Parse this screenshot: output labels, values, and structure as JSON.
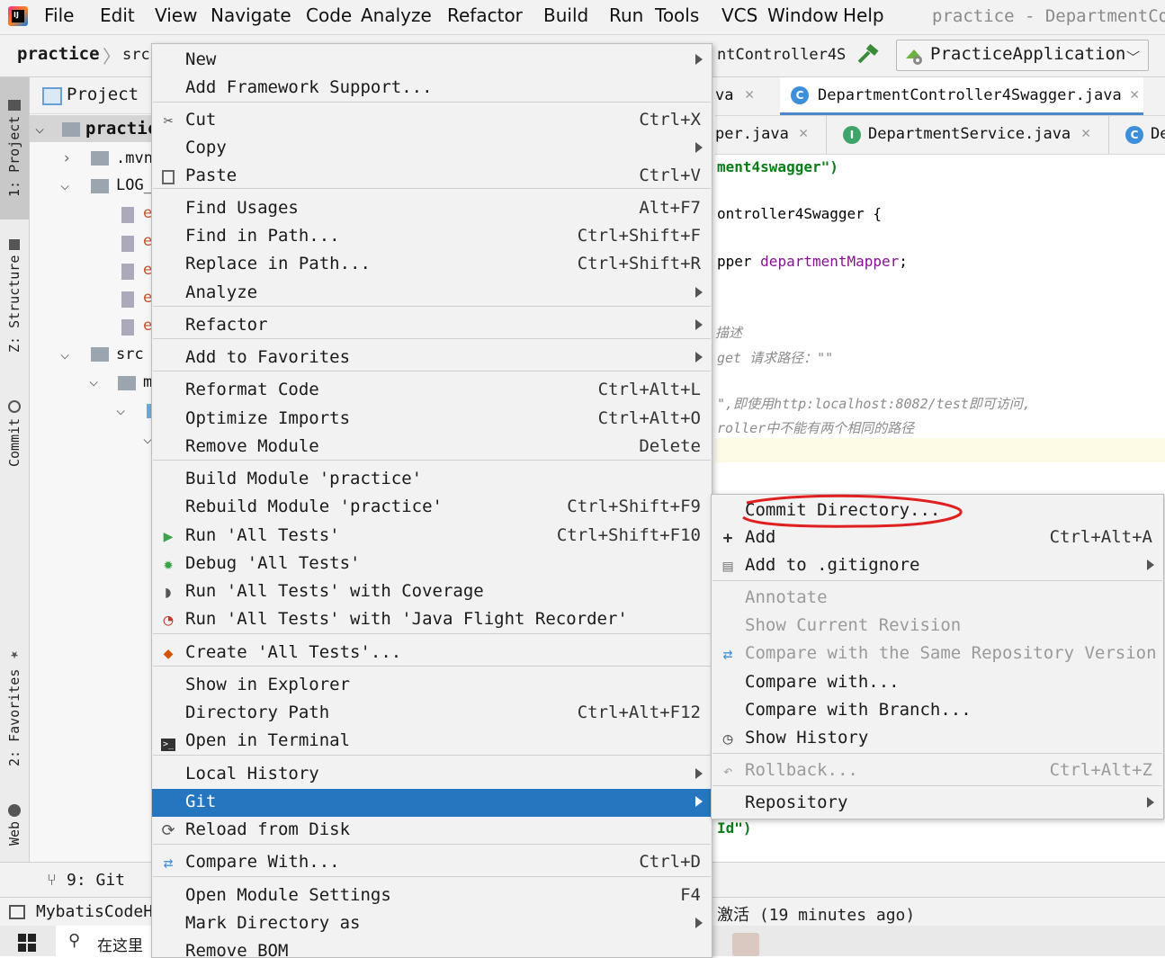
{
  "menubar": {
    "items": [
      "File",
      "Edit",
      "View",
      "Navigate",
      "Code",
      "Analyze",
      "Refactor",
      "Build",
      "Run",
      "Tools",
      "VCS",
      "Window",
      "Help"
    ],
    "title": "practice - DepartmentCor"
  },
  "navbar": {
    "project": "practice",
    "folder": "src",
    "file_partial": "ntController4S",
    "run_config": "PracticeApplication"
  },
  "left_stripe": {
    "project_tab": "1: Project",
    "structure_tab": "Z: Structure",
    "commit_tab": "Commit",
    "favorites_tab": "2: Favorites",
    "web_tab": "Web"
  },
  "project_pane": {
    "title": "Project",
    "items": [
      "practic",
      ".mvn",
      "LOG_",
      "e",
      "e",
      "e",
      "e",
      "e",
      "src",
      "m"
    ]
  },
  "editor_tabs": {
    "row1": [
      "va",
      "DepartmentController4Swagger.java"
    ],
    "row2": [
      "per.java",
      "DepartmentService.java",
      "De"
    ]
  },
  "code_lines": [
    "ment4swagger\")",
    "ontroller4Swagger {",
    "pper departmentMapper;",
    "描述",
    " get   请求路径：\"\"",
    "\",即使用http:localhost:8082/test即可访问,",
    "roller中不能有两个相同的路径",
    "Id\")"
  ],
  "context_menu": {
    "items": [
      {
        "label": "New",
        "shortcut": "",
        "submenu": true
      },
      {
        "label": "Add Framework Support...",
        "shortcut": "",
        "submenu": false
      },
      {
        "label": "Cut",
        "shortcut": "Ctrl+X",
        "submenu": false,
        "icon": "cut-icon"
      },
      {
        "label": "Copy",
        "shortcut": "",
        "submenu": true
      },
      {
        "label": "Paste",
        "shortcut": "Ctrl+V",
        "submenu": false,
        "icon": "paste-icon"
      },
      {
        "label": "Find Usages",
        "shortcut": "Alt+F7",
        "submenu": false
      },
      {
        "label": "Find in Path...",
        "shortcut": "Ctrl+Shift+F",
        "submenu": false
      },
      {
        "label": "Replace in Path...",
        "shortcut": "Ctrl+Shift+R",
        "submenu": false
      },
      {
        "label": "Analyze",
        "shortcut": "",
        "submenu": true
      },
      {
        "label": "Refactor",
        "shortcut": "",
        "submenu": true
      },
      {
        "label": "Add to Favorites",
        "shortcut": "",
        "submenu": true
      },
      {
        "label": "Reformat Code",
        "shortcut": "Ctrl+Alt+L",
        "submenu": false
      },
      {
        "label": "Optimize Imports",
        "shortcut": "Ctrl+Alt+O",
        "submenu": false
      },
      {
        "label": "Remove Module",
        "shortcut": "Delete",
        "submenu": false
      },
      {
        "label": "Build Module 'practice'",
        "shortcut": "",
        "submenu": false
      },
      {
        "label": "Rebuild Module 'practice'",
        "shortcut": "Ctrl+Shift+F9",
        "submenu": false
      },
      {
        "label": "Run 'All Tests'",
        "shortcut": "Ctrl+Shift+F10",
        "submenu": false,
        "icon": "run-icon"
      },
      {
        "label": "Debug 'All Tests'",
        "shortcut": "",
        "submenu": false,
        "icon": "debug-icon"
      },
      {
        "label": "Run 'All Tests' with Coverage",
        "shortcut": "",
        "submenu": false,
        "icon": "coverage-icon"
      },
      {
        "label": "Run 'All Tests' with 'Java Flight Recorder'",
        "shortcut": "",
        "submenu": false,
        "icon": "profiler-icon"
      },
      {
        "label": "Create 'All Tests'...",
        "shortcut": "",
        "submenu": false,
        "icon": "create-test-icon"
      },
      {
        "label": "Show in Explorer",
        "shortcut": "",
        "submenu": false
      },
      {
        "label": "Directory Path",
        "shortcut": "Ctrl+Alt+F12",
        "submenu": false
      },
      {
        "label": "Open in Terminal",
        "shortcut": "",
        "submenu": false,
        "icon": "terminal-icon"
      },
      {
        "label": "Local History",
        "shortcut": "",
        "submenu": true
      },
      {
        "label": "Git",
        "shortcut": "",
        "submenu": true,
        "selected": true
      },
      {
        "label": "Reload from Disk",
        "shortcut": "",
        "submenu": false,
        "icon": "reload-icon"
      },
      {
        "label": "Compare With...",
        "shortcut": "Ctrl+D",
        "submenu": false,
        "icon": "compare-icon"
      },
      {
        "label": "Open Module Settings",
        "shortcut": "F4",
        "submenu": false
      },
      {
        "label": "Mark Directory as",
        "shortcut": "",
        "submenu": true
      },
      {
        "label": "Remove BOM",
        "shortcut": "",
        "submenu": false
      }
    ]
  },
  "git_submenu": {
    "items": [
      {
        "label": "Commit Directory...",
        "shortcut": "",
        "submenu": false,
        "enabled": true
      },
      {
        "label": "Add",
        "shortcut": "Ctrl+Alt+A",
        "submenu": false,
        "enabled": true,
        "icon": "plus-icon"
      },
      {
        "label": "Add to .gitignore",
        "shortcut": "",
        "submenu": true,
        "enabled": true,
        "icon": "gitignore-icon"
      },
      {
        "label": "Annotate",
        "shortcut": "",
        "submenu": false,
        "enabled": false
      },
      {
        "label": "Show Current Revision",
        "shortcut": "",
        "submenu": false,
        "enabled": false
      },
      {
        "label": "Compare with the Same Repository Version",
        "shortcut": "",
        "submenu": false,
        "enabled": false,
        "icon": "compare-icon"
      },
      {
        "label": "Compare with...",
        "shortcut": "",
        "submenu": false,
        "enabled": true
      },
      {
        "label": "Compare with Branch...",
        "shortcut": "",
        "submenu": false,
        "enabled": true
      },
      {
        "label": "Show History",
        "shortcut": "",
        "submenu": false,
        "enabled": true,
        "icon": "history-icon"
      },
      {
        "label": "Rollback...",
        "shortcut": "Ctrl+Alt+Z",
        "submenu": false,
        "enabled": false,
        "icon": "rollback-icon"
      },
      {
        "label": "Repository",
        "shortcut": "",
        "submenu": true,
        "enabled": true
      }
    ]
  },
  "bottom": {
    "git_tab": "9: Git",
    "plugin_tab": "MybatisCodeH",
    "status_text": "激活 (19 minutes ago)",
    "taskbar_search": "在这里"
  },
  "colors": {
    "selection": "#2675bf",
    "keyword": "#000080",
    "field": "#871094",
    "string": "#067d17",
    "annotation_circle": "#e02020"
  }
}
